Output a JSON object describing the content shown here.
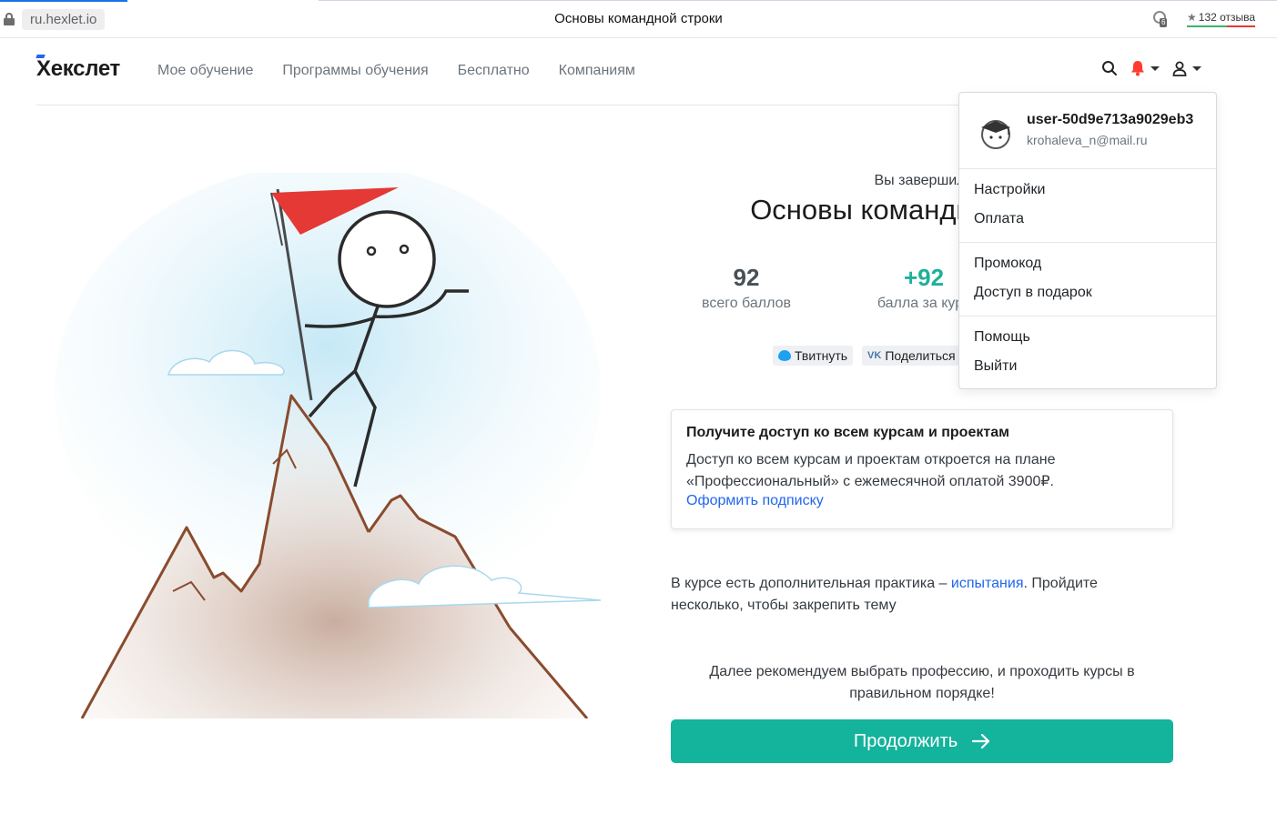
{
  "browser": {
    "url": "ru.hexlet.io",
    "tab_title": "Основы командной строки",
    "extension_badge": "6",
    "reviews": "132 отзыва"
  },
  "header": {
    "logo": "Хекслет",
    "nav": [
      "Мое обучение",
      "Программы обучения",
      "Бесплатно",
      "Компаниям"
    ],
    "icons": [
      "search-icon",
      "bell-icon",
      "user-icon"
    ],
    "bell_color": "#ff3b30"
  },
  "result": {
    "completed_text": "Вы завершили",
    "course_title": "Основы командной строки",
    "total_points": "92",
    "total_points_label": "всего баллов",
    "course_points": "+92",
    "course_points_label": "балла за курс",
    "tweet_label": "Твитнуть",
    "vk_label": "Поделиться VK"
  },
  "promo": {
    "title": "Получите доступ ко всем курсам и проектам",
    "text": "Доступ ко всем курсам и проектам откроется на плане «Профессиональный» с ежемесячной оплатой 3900₽.",
    "link": "Оформить подписку"
  },
  "practice": {
    "before": "В курсе есть дополнительная практика – ",
    "link": "испытания",
    "after": ". Пройдите несколько, чтобы закрепить тему"
  },
  "recommend": "Далее рекомендуем выбрать профессию, и проходить курсы в правильном порядке!",
  "continue_label": "Продолжить",
  "dropdown": {
    "username": "user-50d9e713a9029eb3",
    "email": "krohaleva_n@mail.ru",
    "groups": [
      [
        "Настройки",
        "Оплата"
      ],
      [
        "Промокод",
        "Доступ в подарок"
      ],
      [
        "Помощь",
        "Выйти"
      ]
    ]
  },
  "colors": {
    "accent": "#14b39c",
    "link": "#2067ec",
    "flag": "#e53935"
  }
}
